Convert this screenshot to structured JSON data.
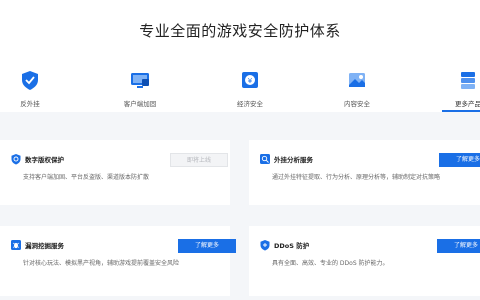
{
  "page": {
    "title": "专业全面的游戏安全防护体系"
  },
  "tabs": [
    {
      "label": "反外挂"
    },
    {
      "label": "客户端加固"
    },
    {
      "label": "经济安全"
    },
    {
      "label": "内容安全"
    },
    {
      "label": "更多产品"
    }
  ],
  "cards": [
    {
      "title": "数字版权保护",
      "desc": "支持客户端加固、平台反盗版、渠道版本防扩散",
      "button": "即将上线",
      "button_state": "disabled"
    },
    {
      "title": "外挂分析服务",
      "desc": "通过外挂特征提取、行为分析、原理分析等，辅助制定对抗策略",
      "button": "了解更多",
      "button_state": "enabled"
    },
    {
      "title": "漏洞挖掘服务",
      "desc": "针对核心玩法、模拟黑产视角，辅助游戏提前覆盖安全风险",
      "button": "了解更多",
      "button_state": "enabled"
    },
    {
      "title": "DDoS 防护",
      "desc": "具有全面、高效、专业的 DDoS 防护能力。",
      "button": "了解更多",
      "button_state": "enabled"
    }
  ],
  "colors": {
    "accent": "#1a6fe6",
    "page_bg": "#f4f6f9",
    "card_bg": "#ffffff"
  }
}
